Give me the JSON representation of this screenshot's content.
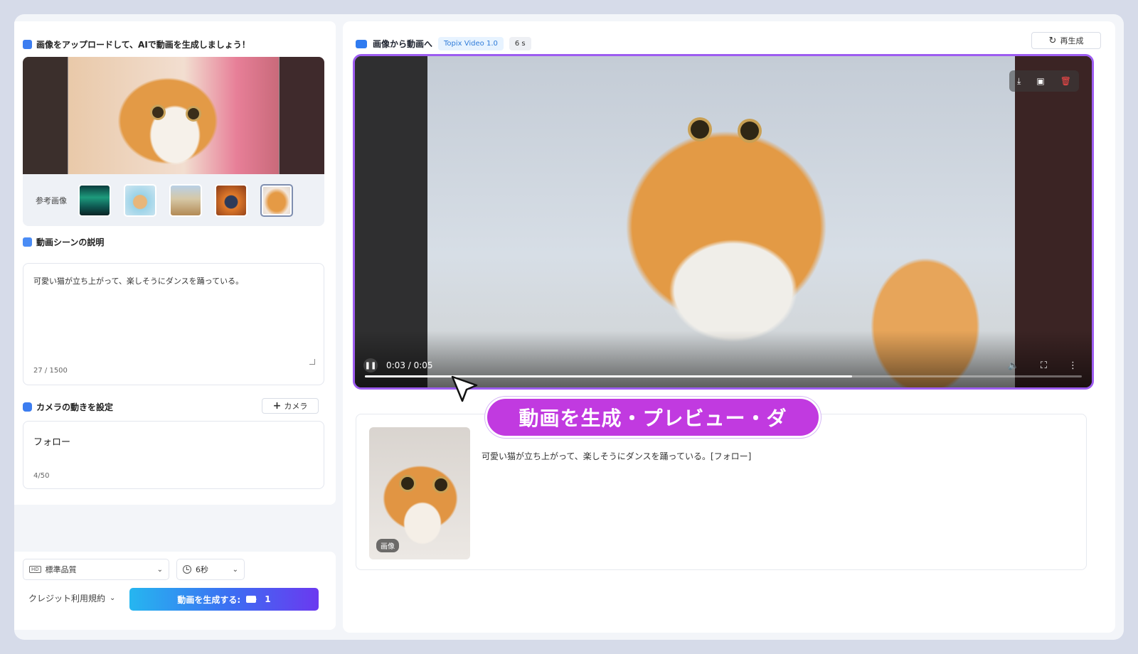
{
  "left": {
    "upload_title": "画像をアップロードして、AIで動画を生成しましょう！",
    "reference_label": "参考画像",
    "scene_title": "動画シーンの説明",
    "scene_text": "可愛い猫が立ち上がって、楽しそうにダンスを踊っている。",
    "scene_count": "27 / 1500",
    "camera_title": "カメラの動きを設定",
    "camera_button": "カメラ",
    "camera_value": "フォロー",
    "camera_count": "4/50",
    "quality_value": "標準品質",
    "duration_value": "6秒",
    "credit_label": "クレジット利用規約",
    "generate_label": "動画を生成する:",
    "generate_cost": "1"
  },
  "right": {
    "title": "画像から動画へ",
    "model_tag": "Topix Video 1.0",
    "duration_tag": "6 s",
    "regen_label": "再生成",
    "video_time": "0:03 / 0:05",
    "progress": 0.68,
    "callout": "動画を生成・プレビュー・ダ",
    "history_text": "可愛い猫が立ち上がって、楽しそうにダンスを踊っている。[フォロー]",
    "history_badge": "画像"
  },
  "colors": {
    "accent_purple": "#9d5cf0",
    "callout_magenta": "#c13ae0",
    "gradient_start": "#26b6f0",
    "gradient_end": "#6b39f0"
  },
  "icons": [
    "image-icon",
    "edit-icon",
    "camera-icon",
    "plus-icon",
    "hd-icon",
    "clock-icon",
    "chevron-down-icon",
    "video-icon",
    "refresh-icon",
    "download-icon",
    "save-icon",
    "trash-icon",
    "pause-icon",
    "volume-icon",
    "fullscreen-icon",
    "more-icon"
  ]
}
